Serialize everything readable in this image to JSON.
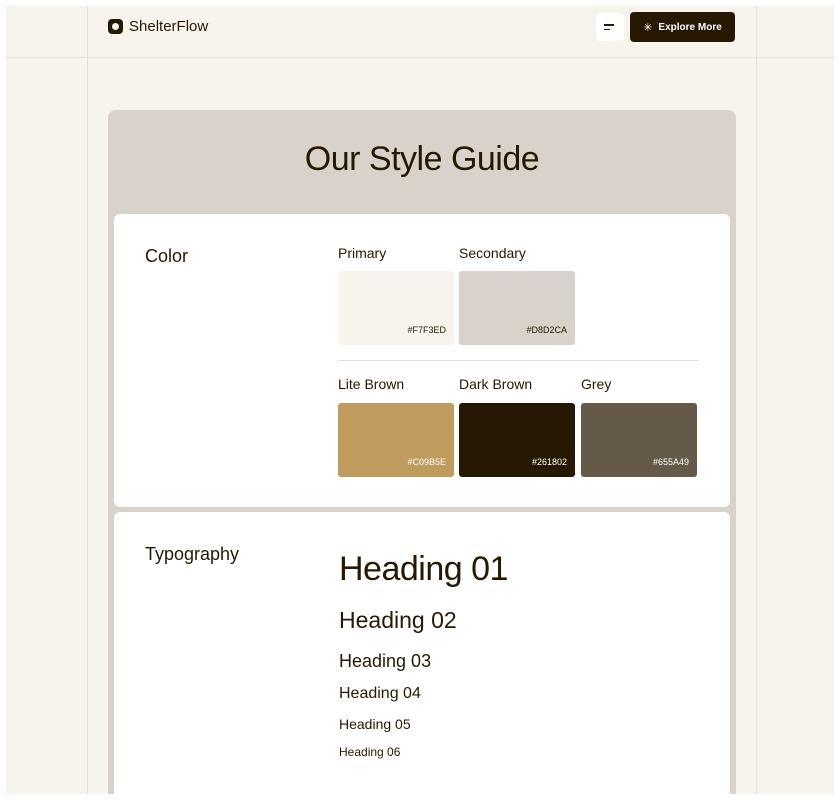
{
  "header": {
    "brand": "ShelterFlow",
    "explore_label": "Explore More"
  },
  "guide": {
    "title": "Our Style Guide"
  },
  "color_section": {
    "label": "Color",
    "swatches": [
      {
        "name": "Primary",
        "hex": "#F7F3ED",
        "text_color": "#261802"
      },
      {
        "name": "Secondary",
        "hex": "#D8D2CA",
        "text_color": "#261802"
      },
      {
        "name": "Lite Brown",
        "hex": "#C09B5E",
        "text_color": "#ffffff"
      },
      {
        "name": "Dark Brown",
        "hex": "#261802",
        "text_color": "#ffffff"
      },
      {
        "name": "Grey",
        "hex": "#655A49",
        "text_color": "#ffffff"
      }
    ]
  },
  "typography_section": {
    "label": "Typography",
    "headings": [
      "Heading 01",
      "Heading 02",
      "Heading 03",
      "Heading 04",
      "Heading 05",
      "Heading 06"
    ]
  }
}
